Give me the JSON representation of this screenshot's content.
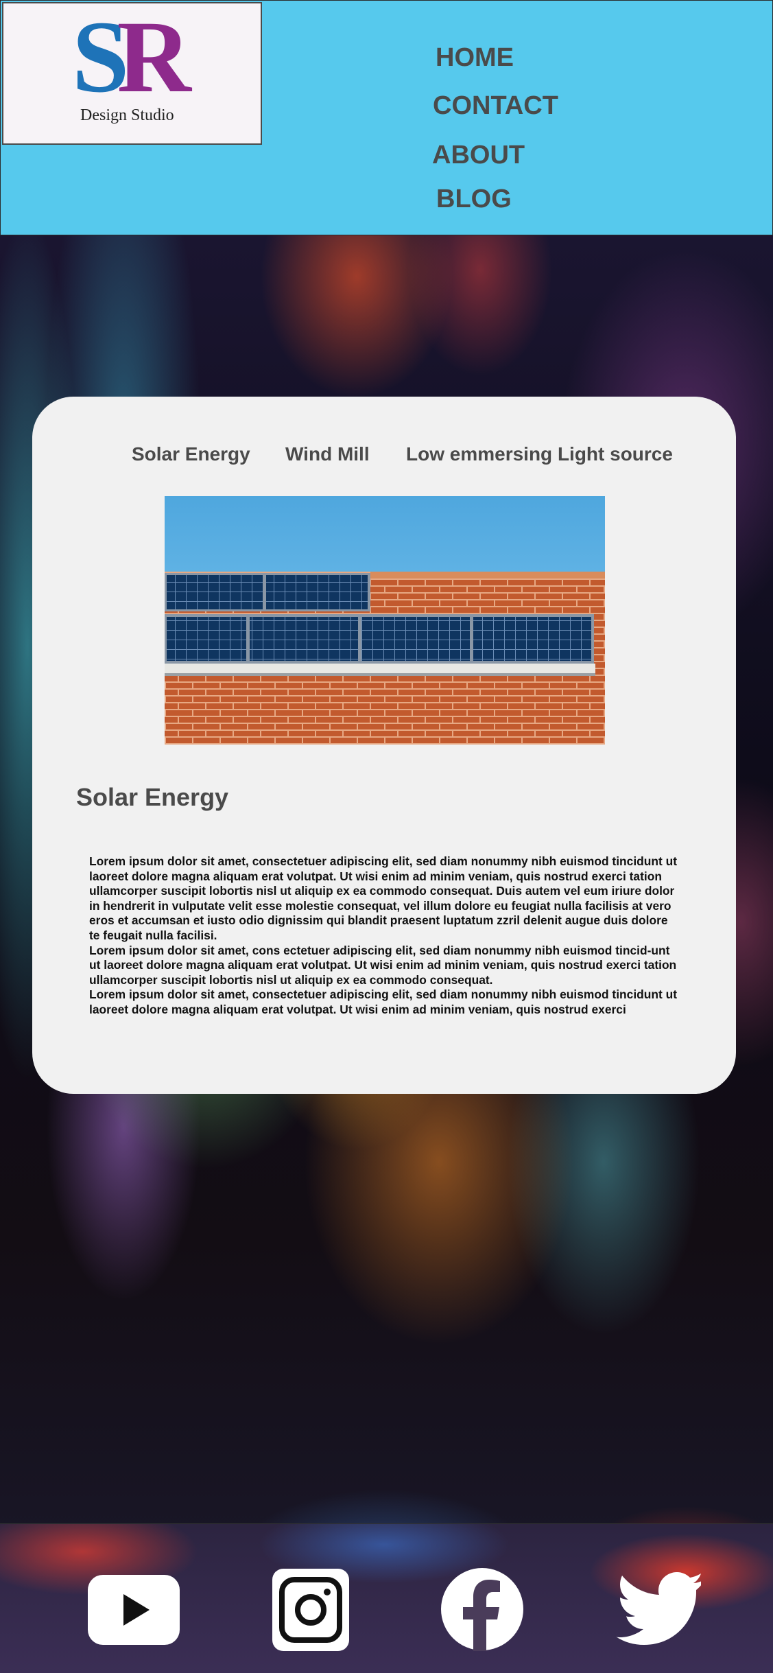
{
  "logo": {
    "letter_s": "S",
    "letter_r": "R",
    "subtitle": "Design Studio"
  },
  "nav": {
    "home": "HOME",
    "contact": "CONTACT",
    "about": "ABOUT",
    "blog": "BLOG"
  },
  "tabs": [
    "Solar Energy",
    "Wind Mill",
    "Low emmersing Light source"
  ],
  "section": {
    "title": "Solar Energy",
    "paragraphs": [
      "Lorem ipsum dolor sit amet, consectetuer adipiscing elit, sed diam nonummy nibh euismod tincidunt ut laoreet dolore magna aliquam erat volutpat. Ut wisi enim ad minim veniam, quis nostrud exerci tation ullamcorper suscipit lobortis nisl ut aliquip ex ea commodo consequat. Duis autem vel eum iriure dolor in hendrerit in vulputate velit esse molestie consequat, vel illum dolore eu feugiat nulla facilisis at vero eros et accumsan et iusto odio dignissim qui blandit praesent luptatum zzril delenit augue duis dolore te feugait nulla facilisi.",
      "Lorem ipsum dolor sit amet, cons ectetuer adipiscing elit, sed diam nonummy nibh euismod tincid-unt ut laoreet dolore magna aliquam erat volutpat. Ut wisi enim ad minim veniam, quis nostrud exerci tation ullamcorper suscipit lobortis nisl ut aliquip ex ea commodo consequat.",
      "Lorem ipsum dolor sit amet, consectetuer adipiscing elit, sed diam nonummy nibh euismod tincidunt ut laoreet dolore magna aliquam erat volutpat. Ut wisi enim ad minim veniam, quis nostrud exerci"
    ]
  },
  "social": [
    "youtube-icon",
    "instagram-icon",
    "facebook-icon",
    "twitter-icon"
  ],
  "colors": {
    "header_bg": "#56c9ed",
    "nav_text": "#4a4a4a",
    "card_bg": "#f1f1f1",
    "logo_blue": "#1e73b8",
    "logo_purple": "#8e2a8c"
  }
}
